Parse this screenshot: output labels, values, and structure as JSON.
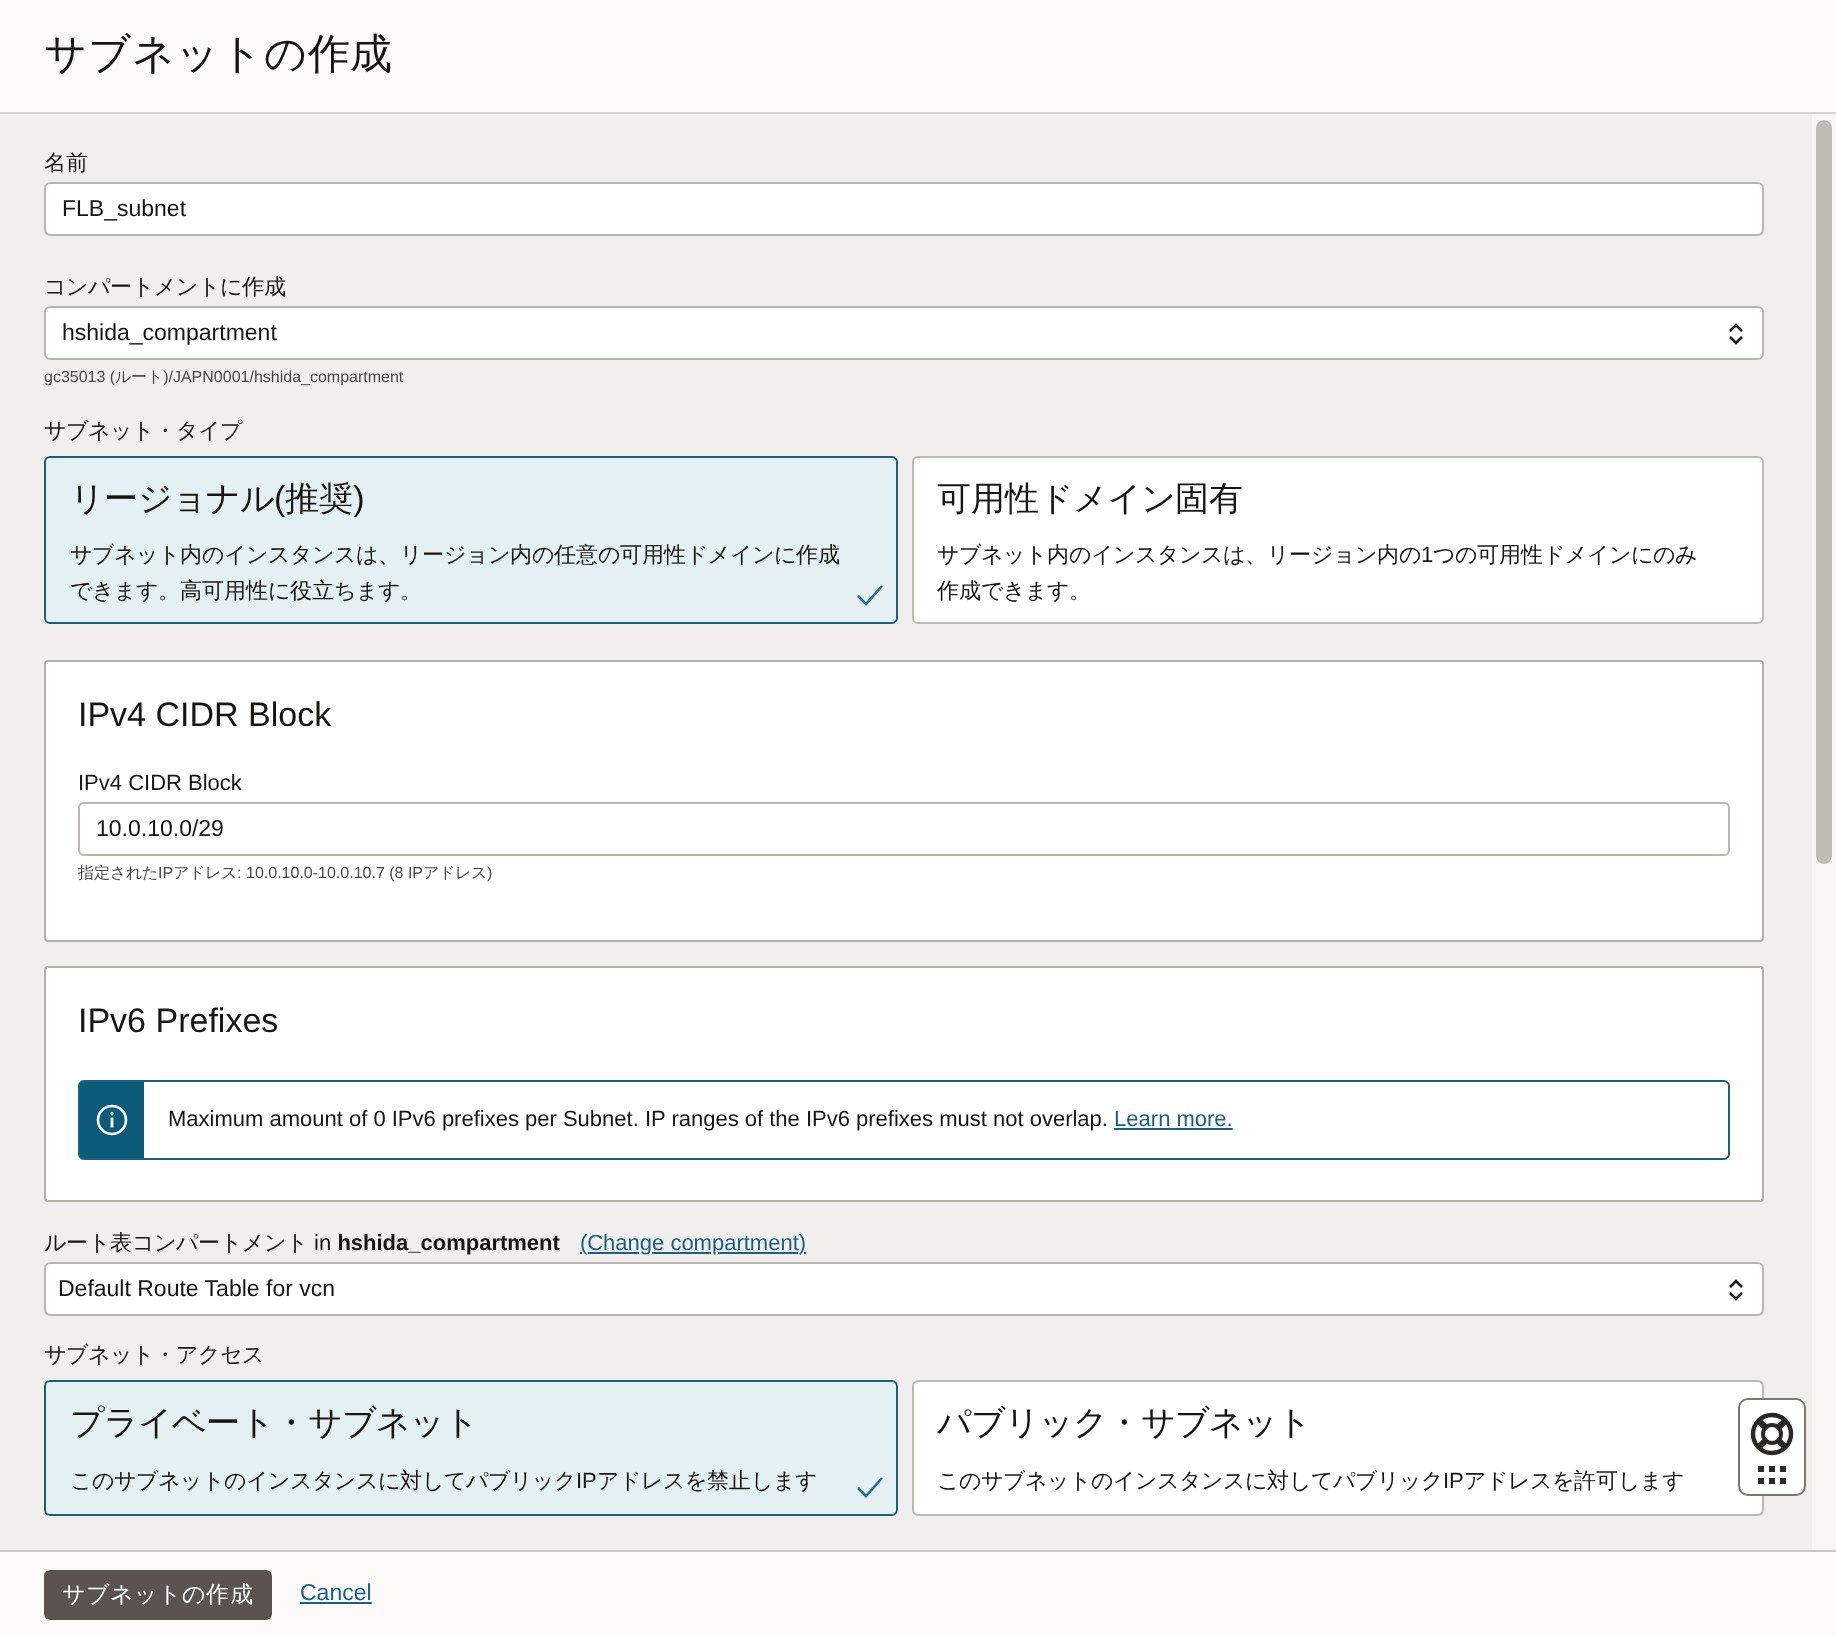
{
  "window": {
    "title": "サブネットの作成"
  },
  "name_field": {
    "label": "名前",
    "value": "FLB_subnet"
  },
  "compartment_field": {
    "label": "コンパートメントに作成",
    "value": "hshida_compartment",
    "help": "gc35013 (ルート)/JAPN0001/hshida_compartment"
  },
  "subnet_type": {
    "label": "サブネット・タイプ",
    "options": [
      {
        "title": "リージョナル(推奨)",
        "description": "サブネット内のインスタンスは、リージョン内の任意の可用性ドメインに作成できます。高可用性に役立ちます。",
        "selected": true
      },
      {
        "title": "可用性ドメイン固有",
        "description": "サブネット内のインスタンスは、リージョン内の1つの可用性ドメインにのみ作成できます。",
        "selected": false
      }
    ]
  },
  "ipv4": {
    "title": "IPv4 CIDR Block",
    "label": "IPv4 CIDR Block",
    "value": "10.0.10.0/29",
    "help": "指定されたIPアドレス: 10.0.10.0-10.0.10.7 (8 IPアドレス)"
  },
  "ipv6": {
    "title": "IPv6 Prefixes",
    "notice": "Maximum amount of 0 IPv6 prefixes per Subnet. IP ranges of the IPv6 prefixes must not overlap.",
    "link": "Learn more."
  },
  "route_table": {
    "label": "ルート表コンパートメント in **hshida_compartment**",
    "change_link": "(Change compartment)",
    "value": "Default Route Table for vcn"
  },
  "subnet_access": {
    "label": "サブネット・アクセス",
    "options": [
      {
        "title": "プライベート・サブネット",
        "description": "このサブネットのインスタンスに対してパブリックIPアドレスを禁止します",
        "selected": true
      },
      {
        "title": "パブリック・サブネット",
        "description": "このサブネットのインスタンスに対してパブリックIPアドレスを許可します",
        "selected": false
      }
    ]
  },
  "footer": {
    "submit": "サブネットの作成",
    "cancel": "Cancel"
  }
}
